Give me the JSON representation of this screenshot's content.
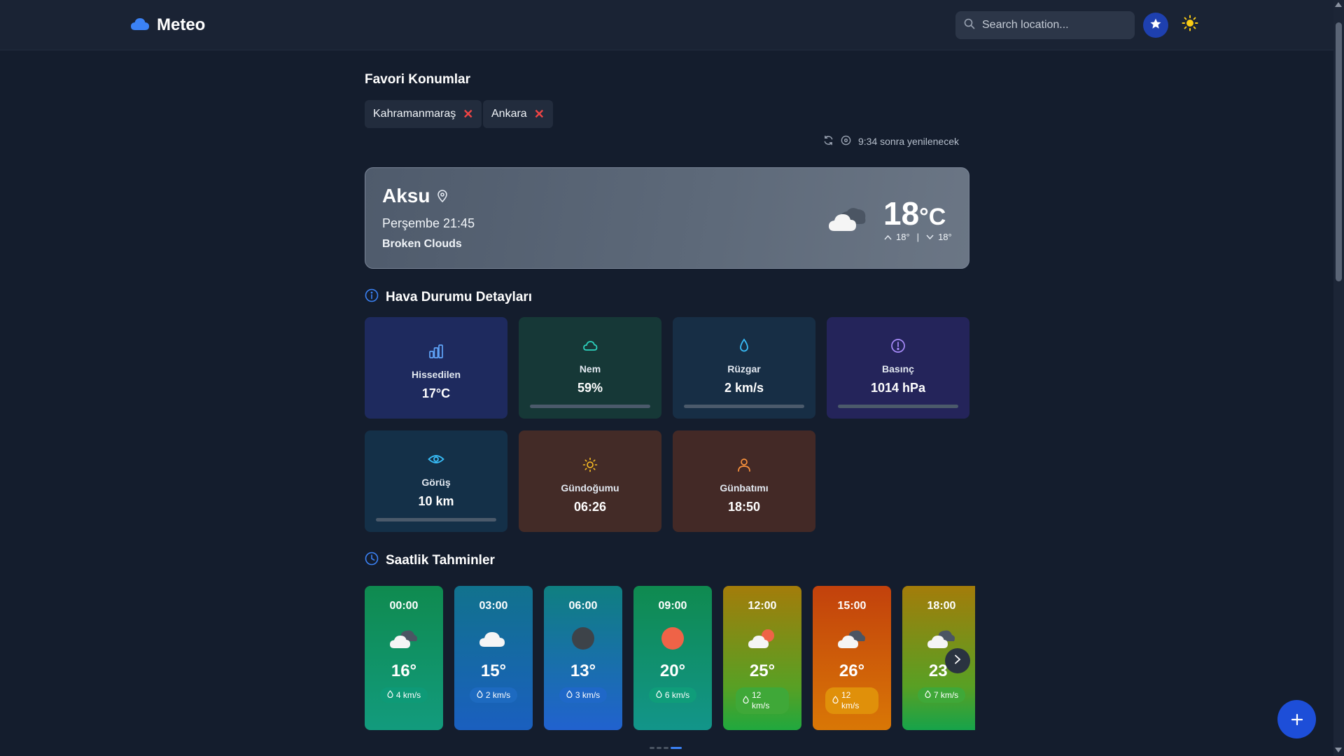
{
  "header": {
    "app_name": "Meteo",
    "search_placeholder": "Search location...",
    "icons": [
      "cloud-logo-icon",
      "search-icon",
      "star-icon",
      "sun-icon"
    ]
  },
  "favorites": {
    "title": "Favori Konumlar",
    "items": [
      {
        "label": "Kahramanmaraş"
      },
      {
        "label": "Ankara"
      }
    ],
    "refresh_text": "9:34 sonra yenilenecek"
  },
  "current": {
    "city": "Aksu",
    "datetime": "Perşembe 21:45",
    "description": "Broken Clouds",
    "temp": "18",
    "unit": "°C",
    "high": "18°",
    "low": "18°"
  },
  "details": {
    "title": "Hava Durumu Detayları",
    "cards": [
      {
        "label": "Hissedilen",
        "value": "17°C",
        "icon": "chart-icon",
        "bar": false,
        "bar_level": null
      },
      {
        "label": "Nem",
        "value": "59%",
        "icon": "cloud-icon",
        "bar": true,
        "bar_level": null
      },
      {
        "label": "Rüzgar",
        "value": "2 km/s",
        "icon": "wind-drop-icon",
        "bar": true,
        "bar_level": null
      },
      {
        "label": "Basınç",
        "value": "1014 hPa",
        "icon": "gauge-icon",
        "bar": true,
        "bar_level": null
      },
      {
        "label": "Görüş",
        "value": "10 km",
        "icon": "eye-icon",
        "bar": true,
        "bar_level": null
      },
      {
        "label": "Gündoğumu",
        "value": "06:26",
        "icon": "sunrise-icon",
        "bar": false,
        "bar_level": null
      },
      {
        "label": "Günbatımı",
        "value": "18:50",
        "icon": "sunset-icon",
        "bar": false,
        "bar_level": null
      }
    ],
    "colors": {
      "feels": "#1e2a5e",
      "humidity": "#163837",
      "wind": "#172e45",
      "pressure": "#24245a",
      "visibility": "#143048",
      "sunrise": "#432b27",
      "sunset": "#432926"
    }
  },
  "hourly": {
    "title": "Saatlik Tahminler",
    "items": [
      {
        "time": "00:00",
        "temp": "16°",
        "wind_speed": "4 km/s",
        "icon": "partly-cloudy-night-icon"
      },
      {
        "time": "03:00",
        "temp": "15°",
        "wind_speed": "2 km/s",
        "icon": "cloud-icon"
      },
      {
        "time": "06:00",
        "temp": "13°",
        "wind_speed": "3 km/s",
        "icon": "moon-icon"
      },
      {
        "time": "09:00",
        "temp": "20°",
        "wind_speed": "6 km/s",
        "icon": "sun-icon"
      },
      {
        "time": "12:00",
        "temp": "25°",
        "wind_speed": "12 km/s",
        "icon": "partly-cloudy-day-icon"
      },
      {
        "time": "15:00",
        "temp": "26°",
        "wind_speed": "12 km/s",
        "icon": "partly-cloudy-night-icon"
      },
      {
        "time": "18:00",
        "temp": "23°",
        "wind_speed": "7 km/s",
        "icon": "partly-cloudy-night-icon"
      }
    ]
  }
}
